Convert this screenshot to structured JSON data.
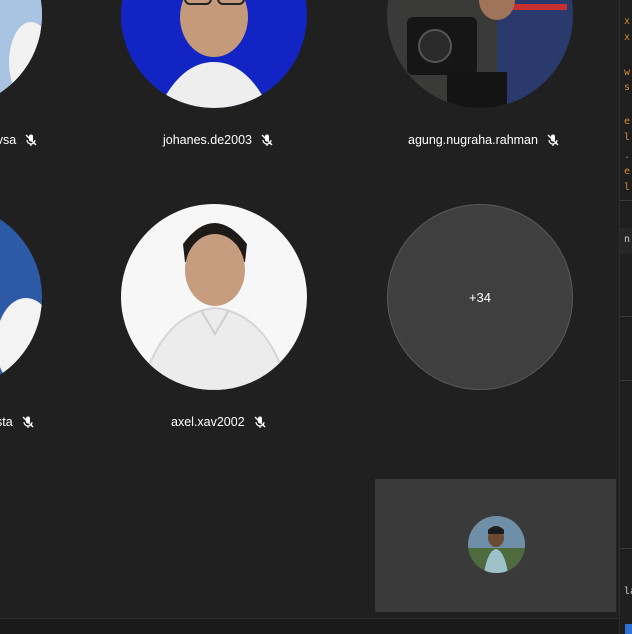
{
  "participants": [
    {
      "name": "ivsa",
      "muted": true
    },
    {
      "name": "johanes.de2003",
      "muted": true
    },
    {
      "name": "agung.nugraha.rahman",
      "muted": true
    },
    {
      "name": "sta",
      "muted": true
    },
    {
      "name": "axel.xav2002",
      "muted": true
    }
  ],
  "overflow_label": "+34",
  "side_panel": {
    "snippets": [
      "x",
      "x",
      "w",
      "s",
      "e",
      "l",
      ".",
      "e",
      "l",
      "n",
      "la"
    ]
  },
  "colors": {
    "background": "#202020",
    "overflow_tile": "#3f3f3f",
    "self_view": "#3a3a3a",
    "accent_orange": "#d7893a",
    "accent_blue": "#2f6fd6"
  }
}
